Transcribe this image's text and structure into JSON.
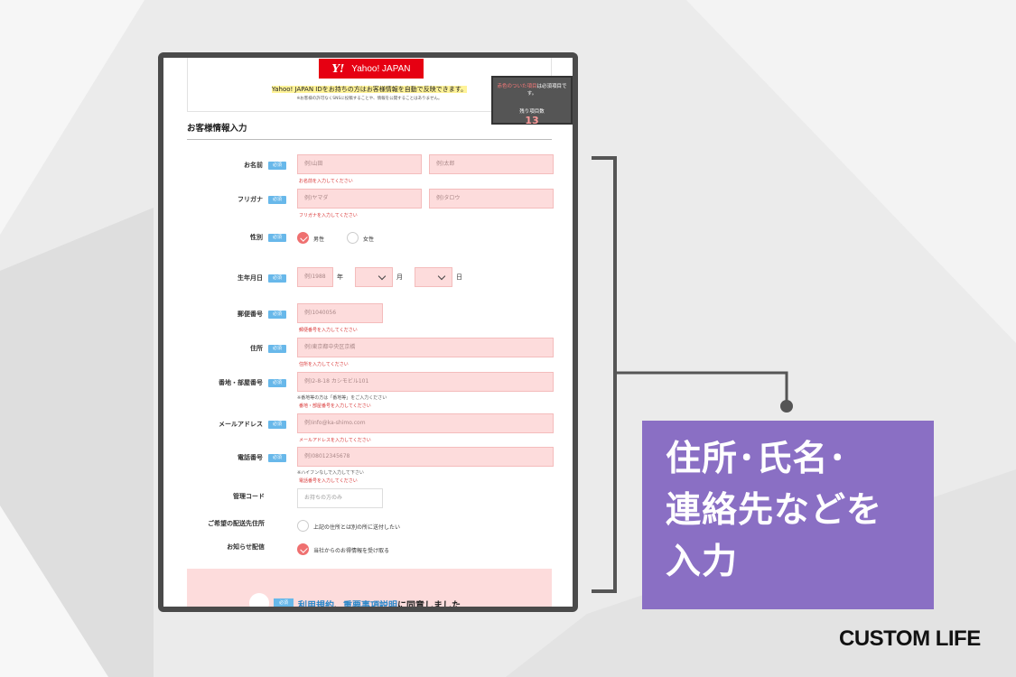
{
  "yahoo": {
    "logo_mark": "Y!",
    "button_label": "Yahoo! JAPAN",
    "note": "Yahoo! JAPAN IDをお持ちの方はお客様情報を自動で反映できます。",
    "subnote": "※お客様の許可なくSNSに投稿することや、情報を公開することはありません。"
  },
  "counter": {
    "prefix": "赤色のついた項目",
    "suffix": "は必須項目です。",
    "label": "残り項目数",
    "count": "13"
  },
  "section_title": "お客様情報入力",
  "required_badge": "必須",
  "fields": {
    "name": {
      "label": "お名前",
      "last_placeholder": "例)山田",
      "first_placeholder": "例)太郎",
      "error": "お名前を入力してください"
    },
    "kana": {
      "label": "フリガナ",
      "last_placeholder": "例)ヤマダ",
      "first_placeholder": "例)タロウ",
      "error": "フリガナを入力してください"
    },
    "gender": {
      "label": "性別",
      "male": "男性",
      "female": "女性"
    },
    "birthday": {
      "label": "生年月日",
      "year_placeholder": "例)1988",
      "year_unit": "年",
      "month_unit": "月",
      "day_unit": "日"
    },
    "postal": {
      "label": "郵便番号",
      "placeholder": "例)1040056",
      "error": "郵便番号を入力してください"
    },
    "address": {
      "label": "住所",
      "placeholder": "例)東京都中央区京橋",
      "error": "住所を入力してください"
    },
    "building": {
      "label": "番地・部屋番号",
      "placeholder": "例)2-8-18 カシモビル101",
      "hint": "※番地等の方は「番地等」をご入力ください",
      "error": "番地・部屋番号を入力してください"
    },
    "email": {
      "label": "メールアドレス",
      "placeholder": "例)info@ka-shimo.com",
      "error": "メールアドレスを入力してください"
    },
    "phone": {
      "label": "電話番号",
      "placeholder": "例)08012345678",
      "hint": "※ハイフンなしで入力して下さい",
      "error": "電話番号を入力してください"
    },
    "code": {
      "label": "管理コード",
      "placeholder": "お持ちの方のみ"
    },
    "delivery": {
      "label": "ご希望の配送先住所",
      "option": "上記の住所とは別の所に送付したい"
    },
    "newsletter": {
      "label": "お知らせ配信",
      "option": "当社からのお得情報を受け取る"
    }
  },
  "agree": {
    "badge": "必須",
    "terms": "利用規約",
    "sep": "、",
    "important": "重要事項説明",
    "suffix": "に同意しました"
  },
  "callout": {
    "line1": "住所･氏名･",
    "line2": "連絡先などを",
    "line3": "入力"
  },
  "brand": "CUSTOM LIFE",
  "colors": {
    "callout_bg": "#8a6fc4",
    "field_pink": "#fddcdc",
    "badge_blue": "#68b8ea",
    "yahoo_red": "#e60012",
    "error_red": "#d83030"
  }
}
